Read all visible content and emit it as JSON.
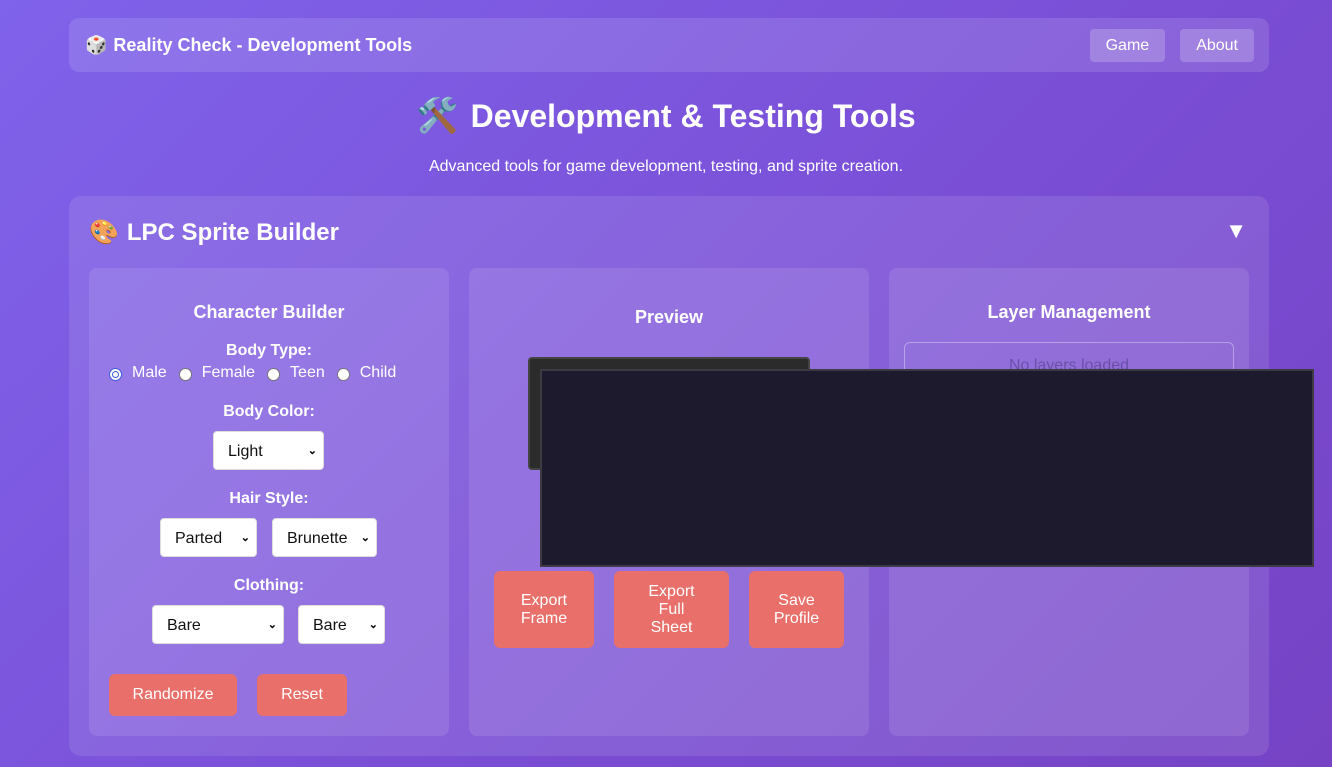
{
  "nav": {
    "brand_icon": "dice-icon",
    "brand_title": "Reality Check - Development Tools",
    "links": [
      {
        "label": "Game"
      },
      {
        "label": "About"
      }
    ]
  },
  "header": {
    "icon": "hammer-wrench-icon",
    "title": "Development & Testing Tools",
    "subtitle": "Advanced tools for game development, testing, and sprite creation."
  },
  "sprite_builder": {
    "icon": "palette-icon",
    "title": "LPC Sprite Builder",
    "toggle": "▼",
    "character_builder": {
      "title": "Character Builder",
      "body_type_label": "Body Type:",
      "body_types": [
        {
          "label": "Male",
          "checked": true
        },
        {
          "label": "Female",
          "checked": false
        },
        {
          "label": "Teen",
          "checked": false
        },
        {
          "label": "Child",
          "checked": false
        }
      ],
      "body_color_label": "Body Color:",
      "body_color_value": "Light",
      "hair_style_label": "Hair Style:",
      "hair_style_value": "Parted",
      "hair_color_value": "Brunette",
      "clothing_label": "Clothing:",
      "clothing_top_value": "Bare",
      "clothing_bottom_value": "Bare",
      "randomize_label": "Randomize",
      "reset_label": "Reset"
    },
    "preview": {
      "title": "Preview",
      "export_frame_label": "Export Frame",
      "export_sheet_label": "Export Full Sheet",
      "save_profile_label": "Save Profile"
    },
    "layers": {
      "title": "Layer Management",
      "empty_text": "No layers loaded"
    }
  },
  "colors": {
    "accent_button": "#e86f6a",
    "overlay": "#1d1a2e"
  }
}
